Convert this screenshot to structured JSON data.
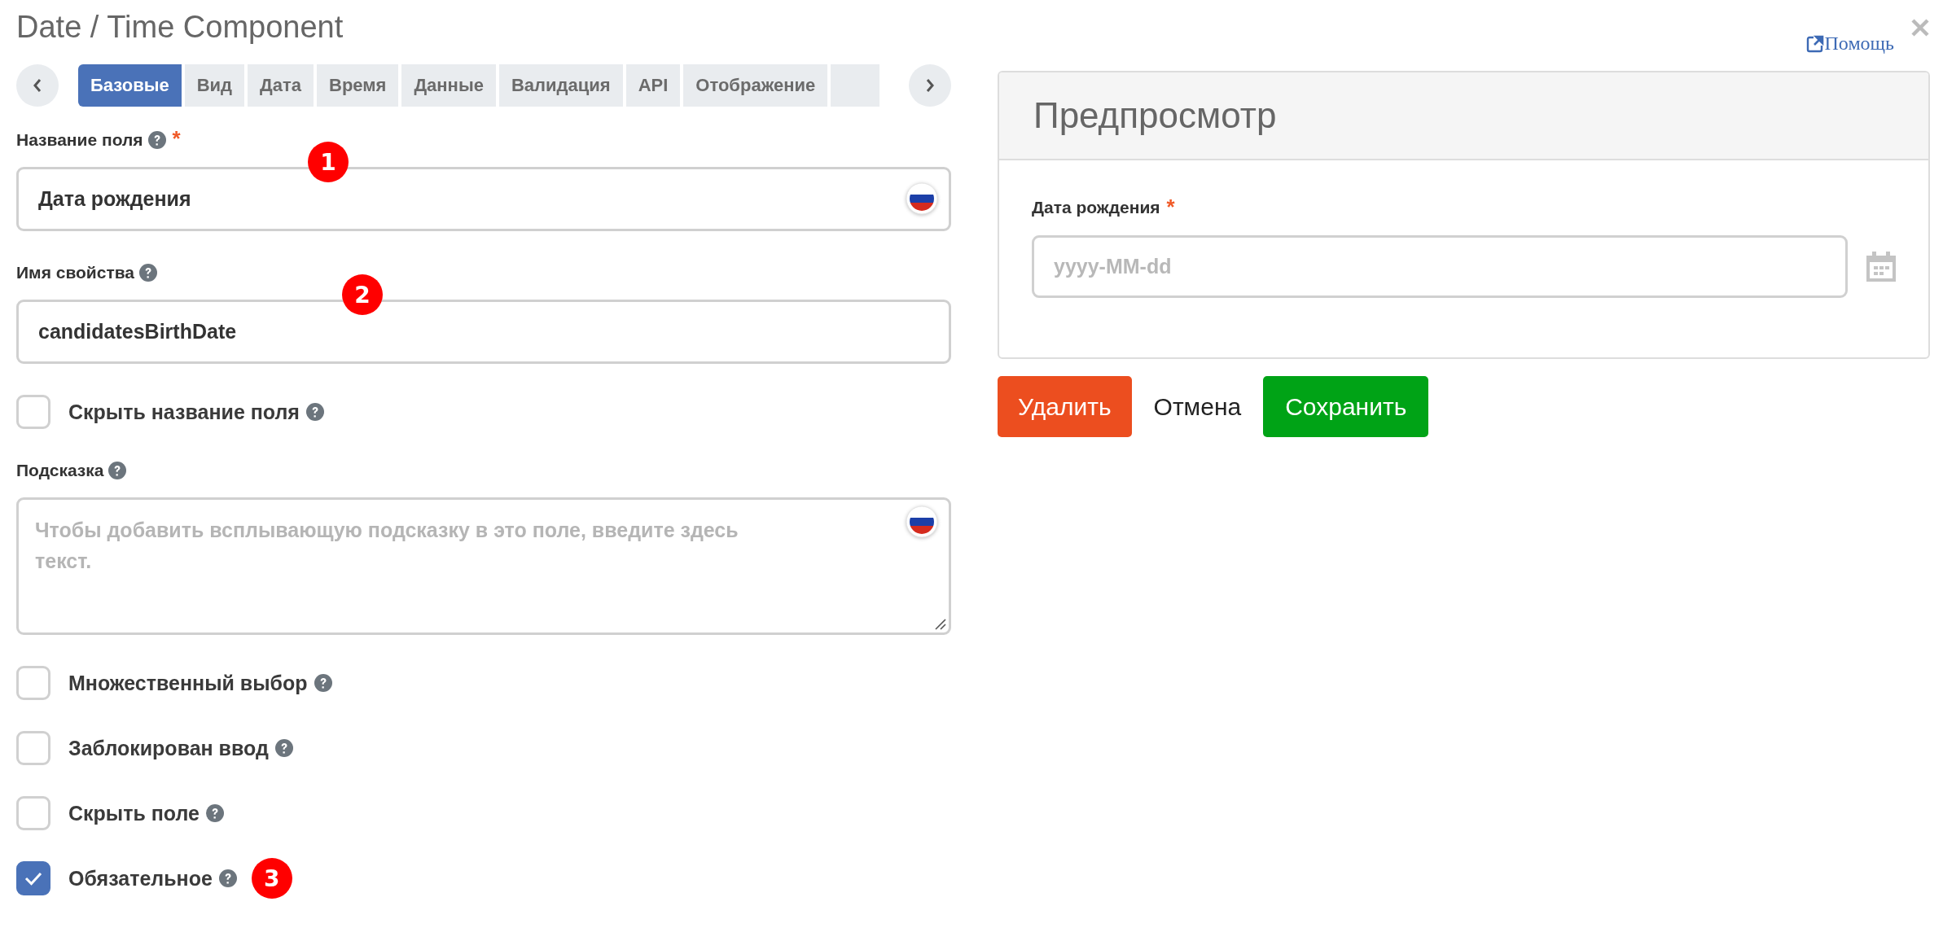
{
  "window": {
    "title": "Date / Time Component"
  },
  "help_link": {
    "label": "Помощь"
  },
  "tabs": [
    {
      "label": "Базовые",
      "selected": true
    },
    {
      "label": "Вид",
      "selected": false
    },
    {
      "label": "Дата",
      "selected": false
    },
    {
      "label": "Время",
      "selected": false
    },
    {
      "label": "Данные",
      "selected": false
    },
    {
      "label": "Валидация",
      "selected": false
    },
    {
      "label": "API",
      "selected": false
    },
    {
      "label": "Отображение",
      "selected": false
    }
  ],
  "fields": [
    {
      "kind": "text",
      "label": "Название поля",
      "help": true,
      "required_mark": "*",
      "value": "Дата рождения",
      "translatable": true,
      "annotation": "1"
    },
    {
      "kind": "text",
      "label": "Имя свойства",
      "help": true,
      "value": "candidatesBirthDate",
      "annotation": "2"
    },
    {
      "kind": "checkbox",
      "label": "Скрыть название поля",
      "help": true,
      "checked": false
    },
    {
      "kind": "textarea",
      "label": "Подсказка",
      "help": true,
      "placeholder": "Чтобы добавить всплывающую подсказку в это поле, введите здесь текст.",
      "translatable": true
    },
    {
      "kind": "checkbox",
      "label": "Множественный выбор",
      "help": true,
      "checked": false
    },
    {
      "kind": "checkbox",
      "label": "Заблокирован ввод",
      "help": true,
      "checked": false
    },
    {
      "kind": "checkbox",
      "label": "Скрыть поле",
      "help": true,
      "checked": false
    },
    {
      "kind": "checkbox",
      "label": "Обязательное",
      "help": true,
      "checked": true,
      "annotation": "3"
    }
  ],
  "preview": {
    "title": "Предпросмотр",
    "field": {
      "label": "Дата рождения",
      "required_mark": "*",
      "placeholder": "yyyy-MM-dd"
    }
  },
  "buttons": [
    {
      "kind": "danger",
      "label": "Удалить"
    },
    {
      "kind": "plain",
      "label": "Отмена"
    },
    {
      "kind": "success",
      "label": "Сохранить"
    }
  ]
}
